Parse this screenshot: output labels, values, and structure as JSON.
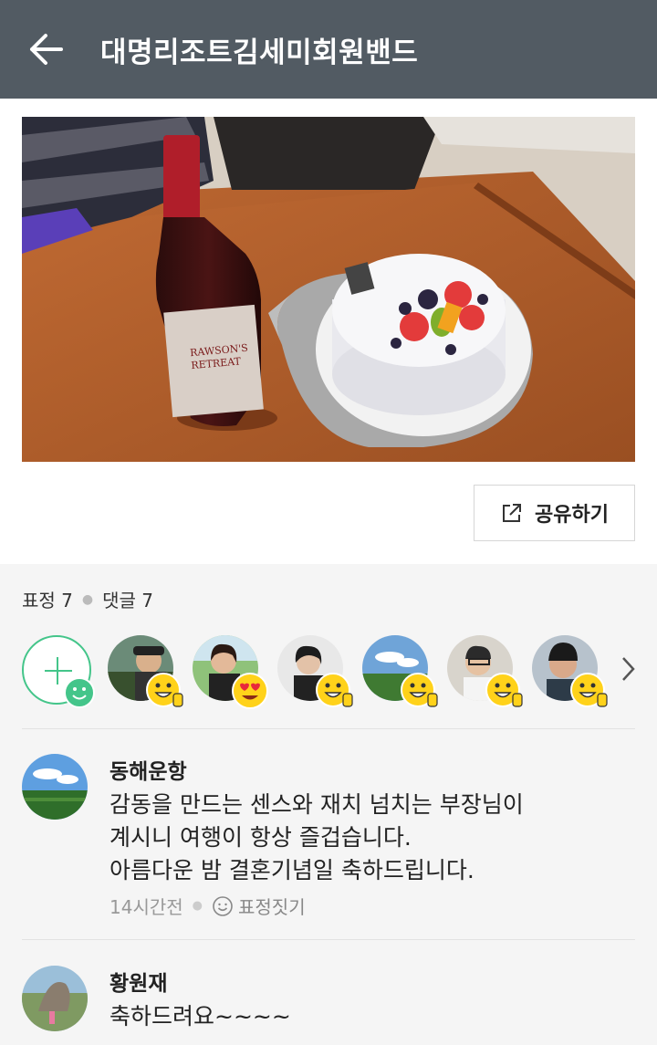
{
  "header": {
    "title": "대명리조트김세미회원밴드"
  },
  "post": {
    "photo_alt": "",
    "share_label": "공유하기"
  },
  "stats": {
    "reactions_label": "표정 7",
    "comments_label": "댓글 7"
  },
  "reactors": [
    {
      "emoji": "thumbs-up-smile"
    },
    {
      "emoji": "heart-eyes"
    },
    {
      "emoji": "thumbs-up-smile"
    },
    {
      "emoji": "thumbs-up-smile"
    },
    {
      "emoji": "thumbs-up-smile"
    },
    {
      "emoji": "thumbs-up-smile"
    }
  ],
  "comments": [
    {
      "author": "동해운항",
      "text": "감동을 만드는 센스와 재치 넘치는 부장님이\n계시니 여행이 항상 즐겁습니다.\n아름다운 밤 결혼기념일 축하드립니다.",
      "time": "14시간전",
      "react_label": "표정짓기"
    },
    {
      "author": "황원재",
      "text": "축하드려요~~~~"
    }
  ],
  "colors": {
    "appbar": "#525b63",
    "accent": "#44c58a"
  }
}
